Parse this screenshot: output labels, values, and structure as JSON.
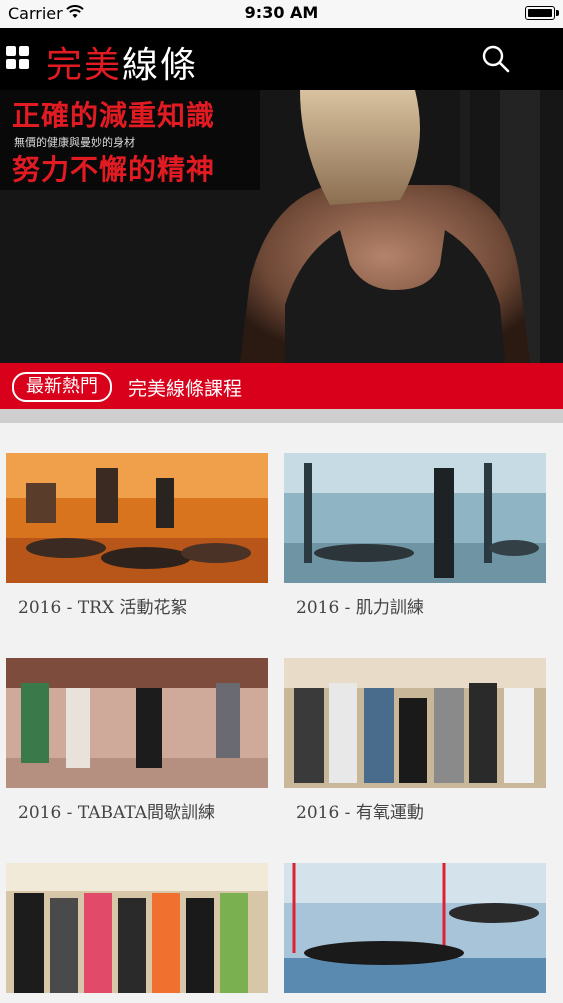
{
  "status_bar": {
    "carrier": "Carrier",
    "time": "9:30 AM"
  },
  "header": {
    "brand_red": "完美",
    "brand_white": "線條"
  },
  "hero": {
    "line1": "正確的減重知識",
    "line2": "無價的健康與曼妙的身材",
    "line3": "努力不懈的精神"
  },
  "section": {
    "pill_label": "最新熱門",
    "title": "完美線條課程"
  },
  "cards": [
    {
      "caption": "2016 - TRX 活動花絮"
    },
    {
      "caption": "2016 - 肌力訓練"
    },
    {
      "caption": "2016 - TABATA間歇訓練"
    },
    {
      "caption": "2016 - 有氧運動"
    },
    {
      "caption": ""
    },
    {
      "caption": ""
    }
  ],
  "colors": {
    "accent_red": "#d9001b",
    "brand_red": "#e21b23",
    "navbar": "#000000"
  },
  "icons": {
    "menu": "grid-menu-icon",
    "search": "search-icon",
    "wifi": "wifi-icon",
    "battery": "battery-icon"
  }
}
